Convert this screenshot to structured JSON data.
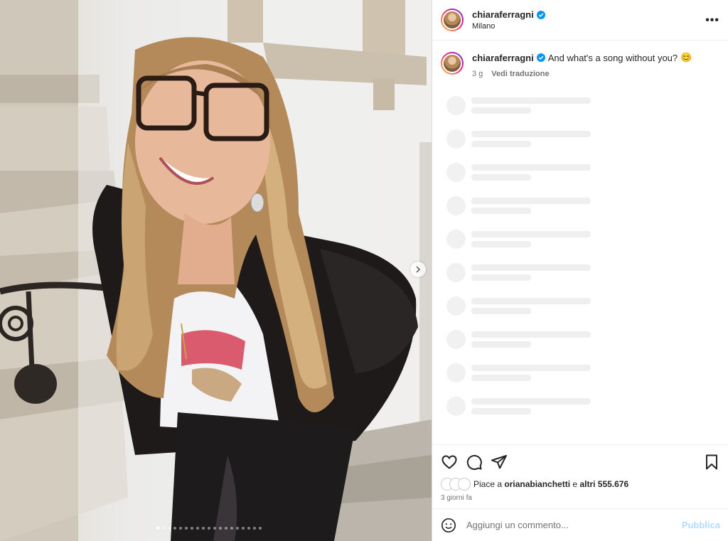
{
  "post": {
    "username": "chiaraferragni",
    "location": "Milano",
    "more_icon": "more-horizontal-icon",
    "verified_color": "#0095f6"
  },
  "caption": {
    "username": "chiaraferragni",
    "text": "And what's a song without you?",
    "emoji": "😊",
    "age": "3 g",
    "translate": "Vedi traduzione"
  },
  "actions": {
    "like_icon": "heart-icon",
    "comment_icon": "comment-icon",
    "share_icon": "send-icon",
    "save_icon": "bookmark-icon"
  },
  "likes": {
    "prefix": "Piace a",
    "user": "orianabianchetti",
    "middle": "e",
    "others": "altri 555.676"
  },
  "date": "3 giorni fa",
  "comment": {
    "placeholder": "Aggiungi un commento...",
    "publish": "Pubblica",
    "emoji_icon": "smiley-icon"
  },
  "carousel": {
    "slide_count": 19,
    "current_index": 1
  },
  "colors": {
    "accent": "#0095f6",
    "publish_disabled": "#b3dbff",
    "skeleton": "#efefef"
  }
}
